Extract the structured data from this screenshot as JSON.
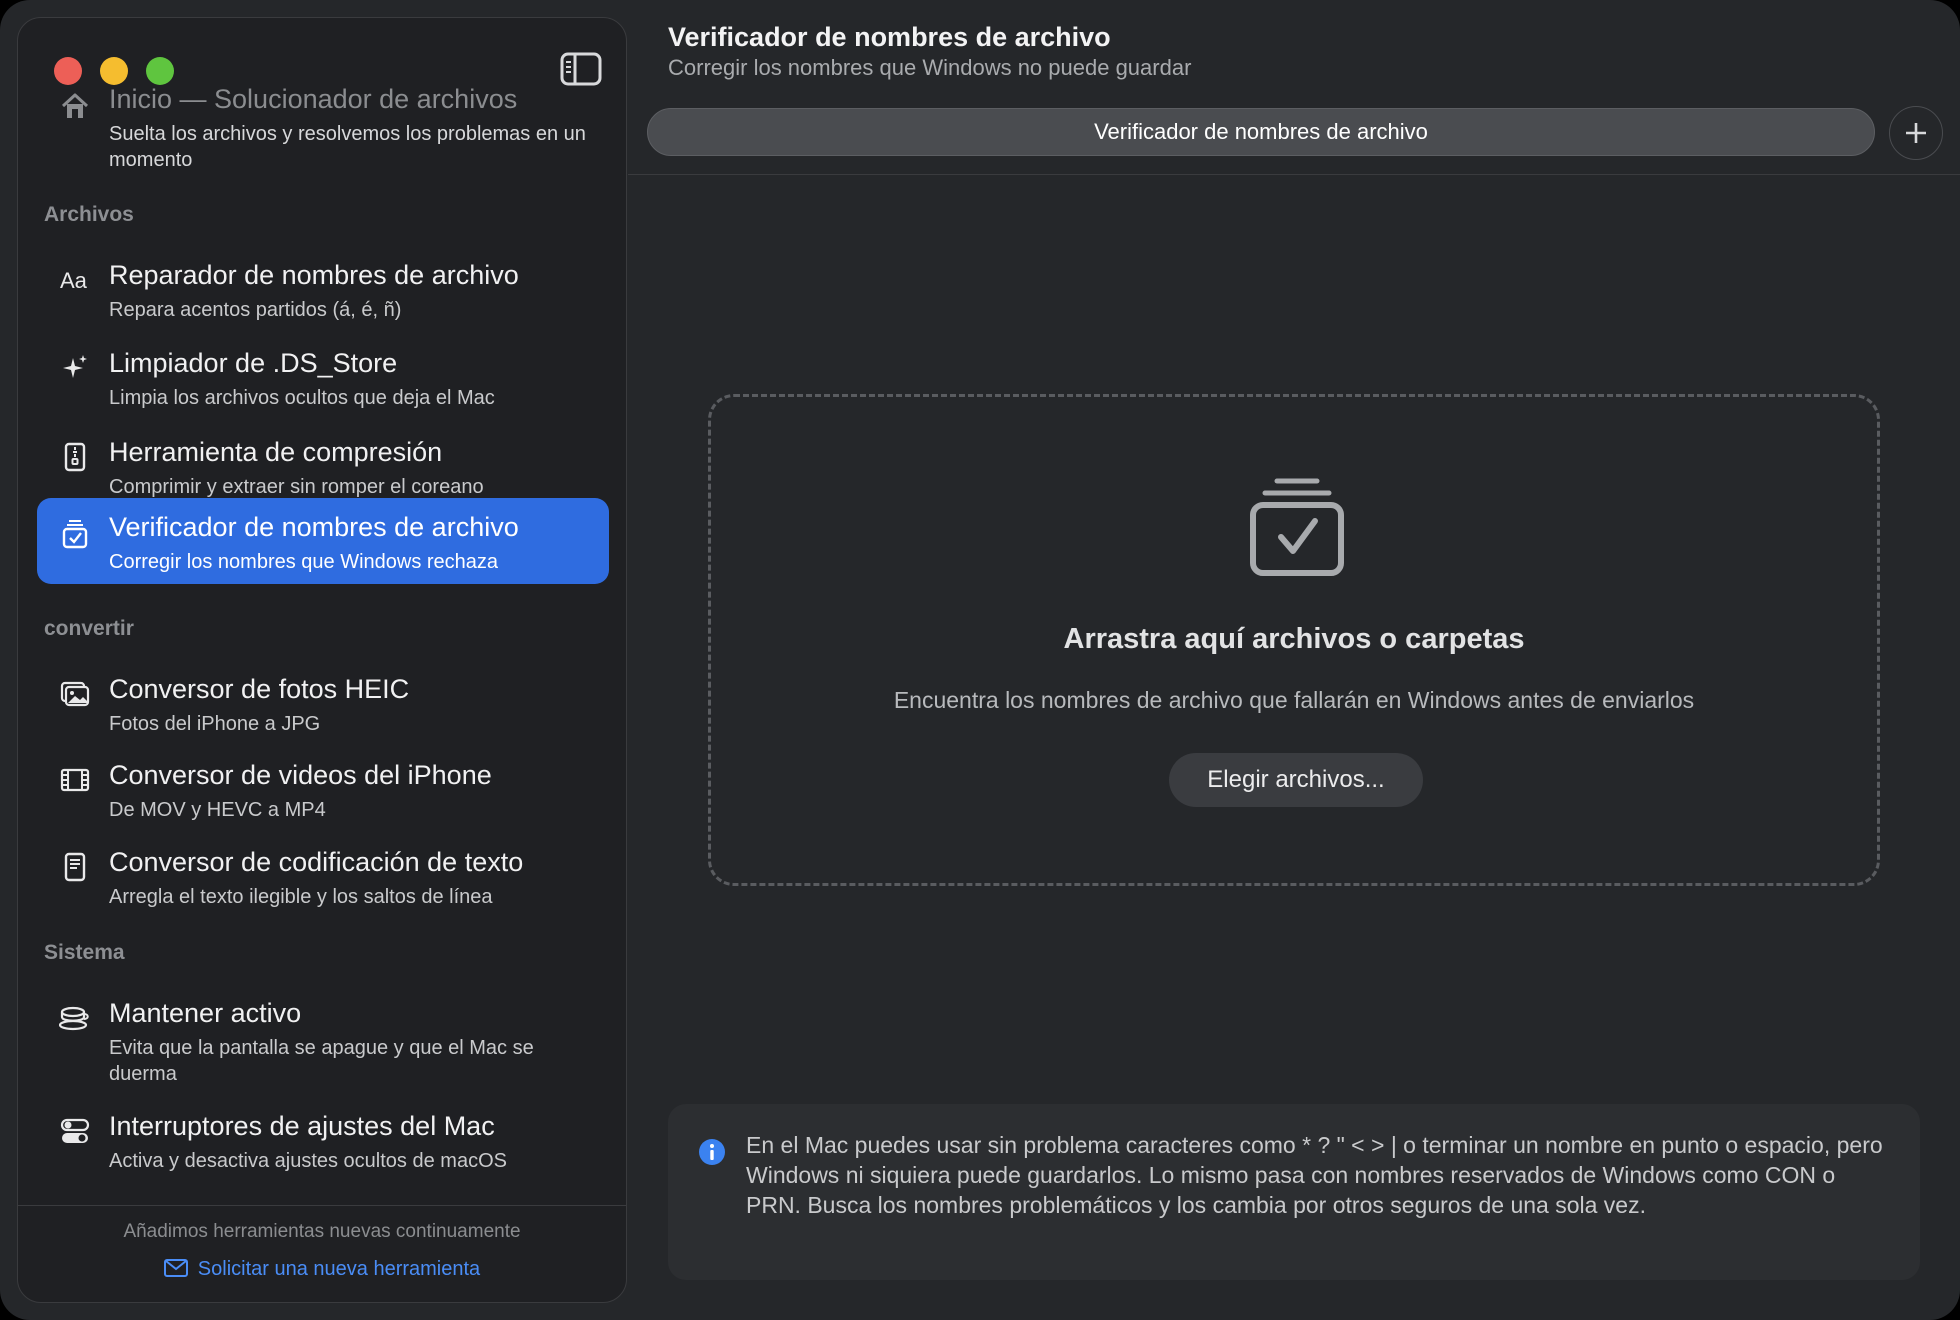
{
  "sidebar": {
    "home": {
      "title": "Inicio — Solucionador de archivos",
      "subtitle": "Suelta los archivos y resolvemos los problemas en un momento"
    },
    "sections": [
      {
        "label": "Archivos",
        "items": [
          {
            "icon": "text-format-icon",
            "title": "Reparador de nombres de archivo",
            "subtitle": "Repara acentos partidos (á, é, ñ)"
          },
          {
            "icon": "sparkles-icon",
            "title": "Limpiador de .DS_Store",
            "subtitle": "Limpia los archivos ocultos que deja el Mac"
          },
          {
            "icon": "zip-icon",
            "title": "Herramienta de compresión",
            "subtitle": "Comprimir y extraer sin romper el coreano"
          },
          {
            "icon": "checklist-tray-icon",
            "title": "Verificador de nombres de archivo",
            "subtitle": "Corregir los nombres que Windows rechaza",
            "active": true
          }
        ]
      },
      {
        "label": "convertir",
        "items": [
          {
            "icon": "photos-icon",
            "title": "Conversor de fotos HEIC",
            "subtitle": "Fotos del iPhone a JPG"
          },
          {
            "icon": "film-icon",
            "title": "Conversor de videos del iPhone",
            "subtitle": "De MOV y HEVC a MP4"
          },
          {
            "icon": "document-icon",
            "title": "Conversor de codificación de texto",
            "subtitle": "Arregla el texto ilegible y los saltos de línea"
          }
        ]
      },
      {
        "label": "Sistema",
        "items": [
          {
            "icon": "coffee-cup-icon",
            "title": "Mantener activo",
            "subtitle": "Evita que la pantalla se apague y que el Mac se duerma"
          },
          {
            "icon": "toggles-icon",
            "title": "Interruptores de ajustes del Mac",
            "subtitle": "Activa y desactiva ajustes ocultos de macOS"
          }
        ]
      }
    ],
    "footer": {
      "text": "Añadimos herramientas nuevas continuamente",
      "link": "Solicitar una nueva herramienta"
    }
  },
  "main": {
    "title": "Verificador de nombres de archivo",
    "subtitle": "Corregir los nombres que Windows no puede guardar",
    "tab_label": "Verificador de nombres de archivo",
    "dropzone": {
      "title": "Arrastra aquí archivos o carpetas",
      "subtitle": "Encuentra los nombres de archivo que fallarán en Windows antes de enviarlos",
      "button": "Elegir archivos..."
    },
    "info": "En el Mac puedes usar sin problema caracteres como * ? \" < > | o terminar un nombre en punto o espacio, pero Windows ni siquiera puede guardarlos. Lo mismo pasa con nombres reservados de Windows como CON o PRN. Busca los nombres problemáticos y los cambia por otros seguros de una sola vez."
  },
  "colors": {
    "accent": "#2f6ce0",
    "link": "#4a8df6"
  }
}
